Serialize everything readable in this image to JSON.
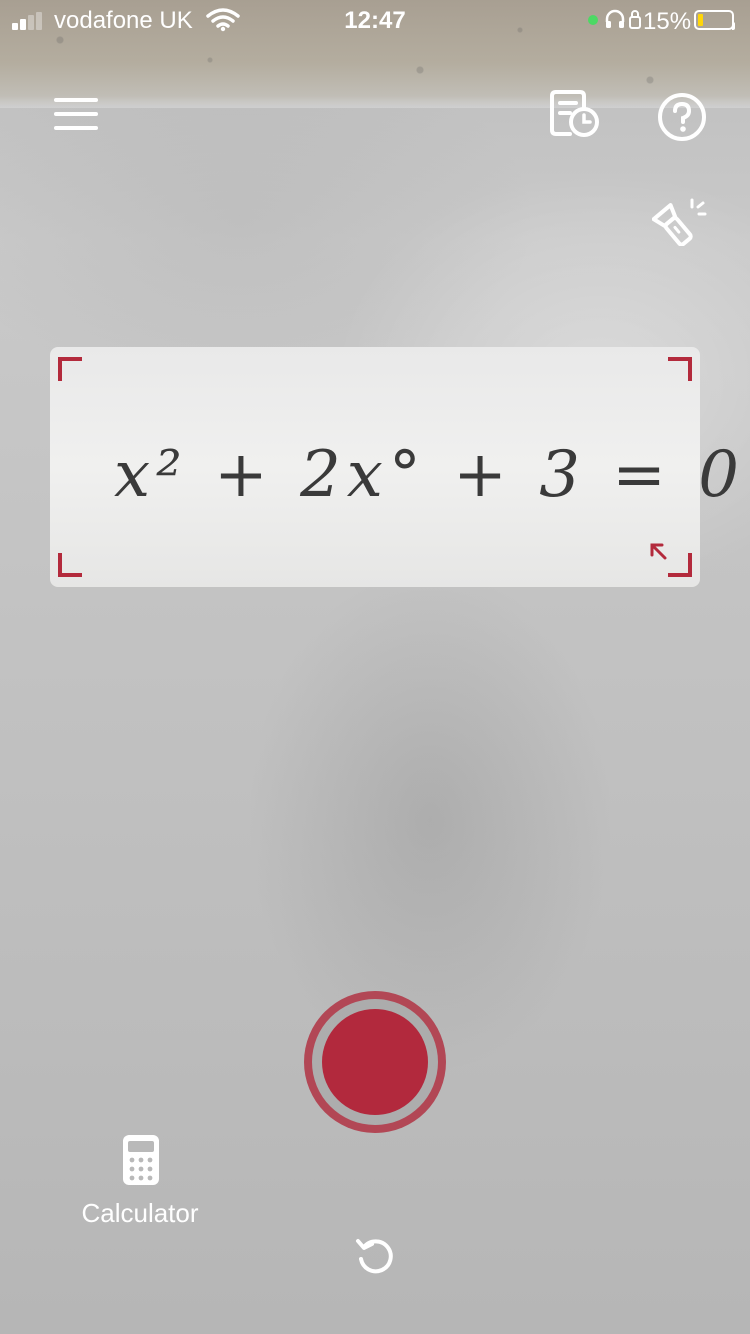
{
  "status_bar": {
    "carrier": "vodafone UK",
    "time": "12:47",
    "battery_percent": "15%",
    "battery_level": 0.15,
    "icons": [
      "signal-icon",
      "wifi-icon",
      "location-dot-icon",
      "headphones-icon",
      "rotation-lock-icon",
      "battery-icon"
    ]
  },
  "toolbar": {
    "icons": [
      "menu-icon",
      "history-icon",
      "help-icon",
      "flashlight-icon"
    ]
  },
  "scan_area": {
    "equation": "x² + 2x° + 3 = 0",
    "accent_color": "#b32a3c",
    "icons": [
      "resize-handle-icon"
    ]
  },
  "controls": {
    "shutter_color": "#b2293d",
    "calculator_label": "Calculator",
    "icons": [
      "calculator-icon",
      "rotate-icon"
    ]
  }
}
